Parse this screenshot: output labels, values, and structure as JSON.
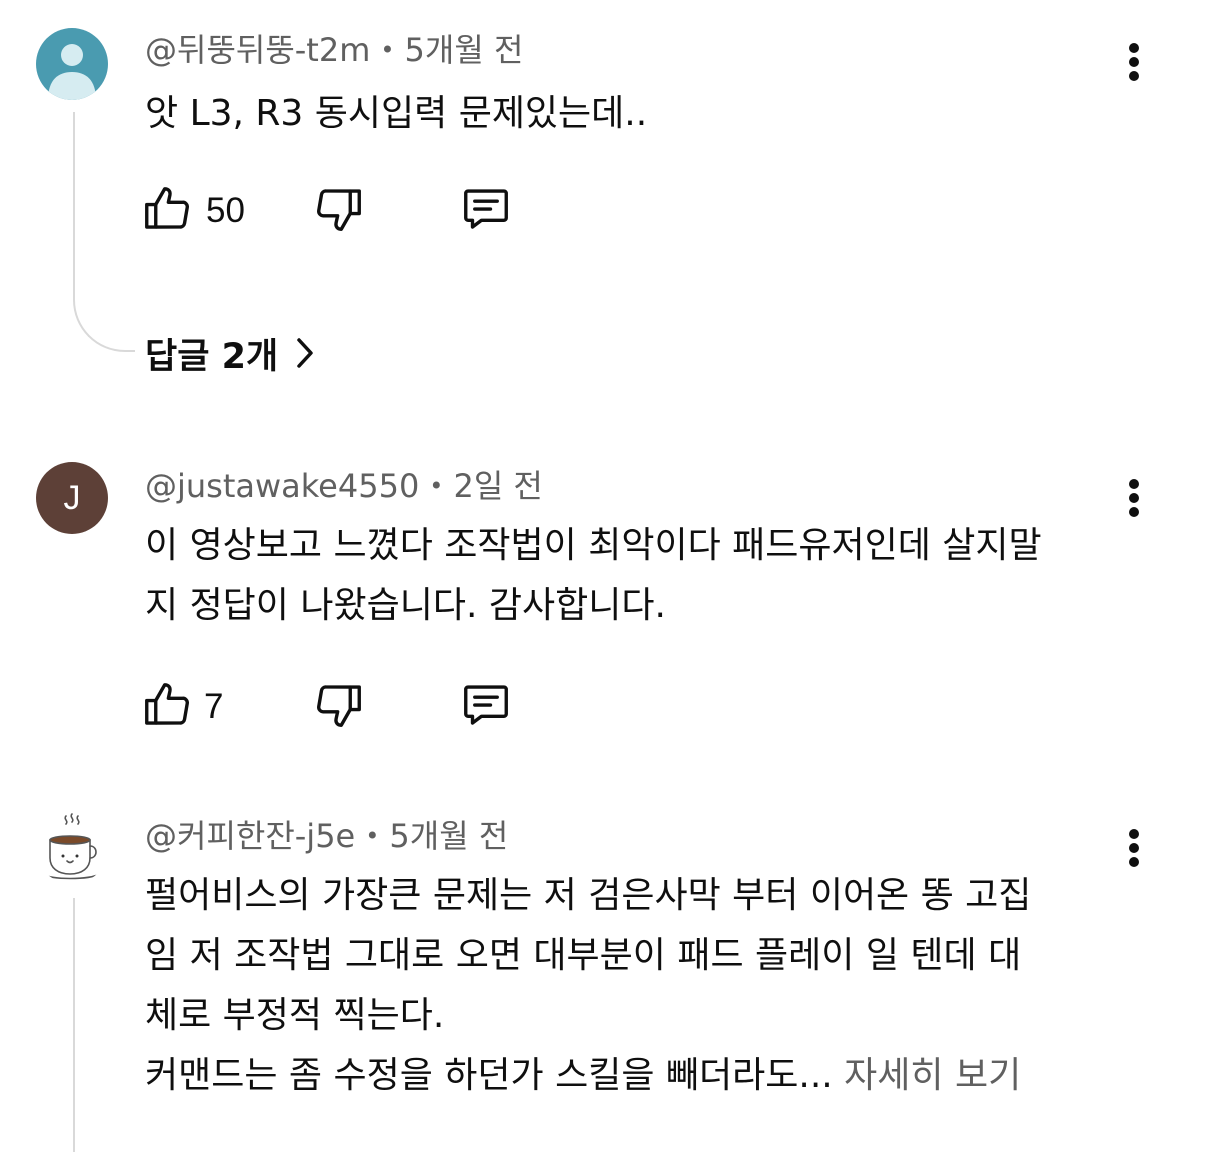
{
  "comments": [
    {
      "author": "@뒤뚱뒤뚱-t2m",
      "time": "5개월 전",
      "text": "앗 L3, R3 동시입력 문제있는데..",
      "likes": "50",
      "avatar_icon": "person-silhouette-icon",
      "replies_label": "답글 2개"
    },
    {
      "author": "@justawake4550",
      "time": "2일 전",
      "avatar_letter": "J",
      "lines": [
        "이 영상보고 느꼈다 조작법이 최악이다 패드유저인데 살지말",
        "지 정답이 나왔습니다. 감사합니다."
      ],
      "likes": "7"
    },
    {
      "author": "@커피한잔-j5e",
      "time": "5개월 전",
      "avatar_icon": "coffee-cup-icon",
      "lines": [
        "펄어비스의 가장큰 문제는 저 검은사막 부터 이어온 똥 고집",
        "임 저 조작법 그대로 오면 대부분이 패드 플레이 일 텐데 대",
        "체로 부정적 찍는다.",
        "커맨드는 좀 수정을 하던가 스킬을 빼더라도..."
      ],
      "more_label": "자세히 보기"
    }
  ],
  "colors": {
    "text": "#0f0f0f",
    "secondary": "#606060",
    "avatar_teal": "#4a9bb0",
    "avatar_brown": "#5d4037",
    "thread_line": "#d9d9d9"
  }
}
